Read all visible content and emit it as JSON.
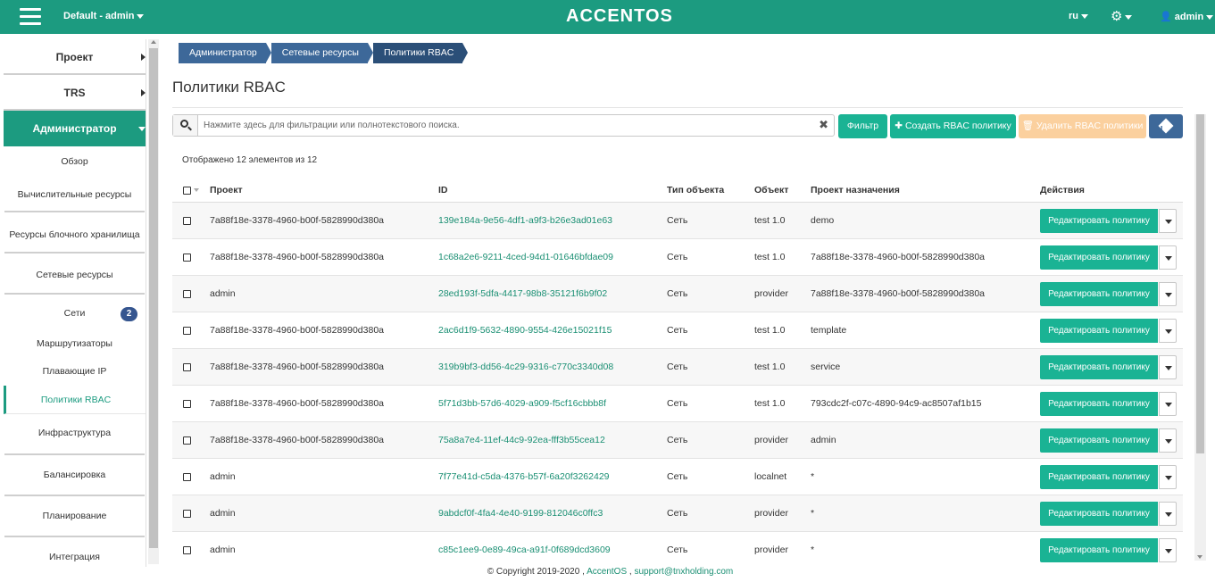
{
  "topbar": {
    "project": "Default - admin",
    "logo": "ACCENTOS",
    "lang": "ru",
    "user": "admin",
    "colors": {
      "brand": "#1c9b80",
      "breadcrumb": "#3d6899"
    }
  },
  "sidebar": {
    "sections": [
      "Проект",
      "TRS",
      "Администратор"
    ],
    "admin_items": [
      "Обзор",
      "Вычислительные ресурсы",
      "Ресурсы блочного хранилища",
      "Сетевые ресурсы"
    ],
    "network_items": [
      {
        "label": "Сети",
        "badge": "2"
      },
      {
        "label": "Маршрутизаторы"
      },
      {
        "label": "Плавающие IP"
      },
      {
        "label": "Политики RBAC"
      }
    ],
    "more_items": [
      "Инфраструктура",
      "Балансировка",
      "Планирование",
      "Интеграция"
    ]
  },
  "breadcrumbs": [
    "Администратор",
    "Сетевые ресурсы",
    "Политики RBAC"
  ],
  "page": {
    "title": "Политики RBAC",
    "search_placeholder": "Нажмите здесь для фильтрации или полнотекстового поиска.",
    "filter_label": "Фильтр",
    "create_label": "Создать RBAC политику",
    "delete_label": "Удалить RBAC политики",
    "count_text": "Отображено 12 элементов из 12"
  },
  "table": {
    "headers": [
      "Проект",
      "ID",
      "Тип объекта",
      "Объект",
      "Проект назначения",
      "Действия"
    ],
    "action_label": "Редактировать политику",
    "rows": [
      {
        "project": "7a88f18e-3378-4960-b00f-5828990d380a",
        "id": "139e184a-9e56-4df1-a9f3-b26e3ad01e63",
        "type": "Сеть",
        "object": "test 1.0",
        "target": "demo"
      },
      {
        "project": "7a88f18e-3378-4960-b00f-5828990d380a",
        "id": "1c68a2e6-9211-4ced-94d1-01646bfdae09",
        "type": "Сеть",
        "object": "test 1.0",
        "target": "7a88f18e-3378-4960-b00f-5828990d380a"
      },
      {
        "project": "admin",
        "id": "28ed193f-5dfa-4417-98b8-35121f6b9f02",
        "type": "Сеть",
        "object": "provider",
        "target": "7a88f18e-3378-4960-b00f-5828990d380a"
      },
      {
        "project": "7a88f18e-3378-4960-b00f-5828990d380a",
        "id": "2ac6d1f9-5632-4890-9554-426e15021f15",
        "type": "Сеть",
        "object": "test 1.0",
        "target": "template"
      },
      {
        "project": "7a88f18e-3378-4960-b00f-5828990d380a",
        "id": "319b9bf3-dd56-4c29-9316-c770c3340d08",
        "type": "Сеть",
        "object": "test 1.0",
        "target": "service"
      },
      {
        "project": "7a88f18e-3378-4960-b00f-5828990d380a",
        "id": "5f71d3bb-57d6-4029-a909-f5cf16cbbb8f",
        "type": "Сеть",
        "object": "test 1.0",
        "target": "793cdc2f-c07c-4890-94c9-ac8507af1b15"
      },
      {
        "project": "7a88f18e-3378-4960-b00f-5828990d380a",
        "id": "75a8a7e4-11ef-44c9-92ea-fff3b55cea12",
        "type": "Сеть",
        "object": "provider",
        "target": "admin"
      },
      {
        "project": "admin",
        "id": "7f77e41d-c5da-4376-b57f-6a20f3262429",
        "type": "Сеть",
        "object": "localnet",
        "target": "*"
      },
      {
        "project": "admin",
        "id": "9abdcf0f-4fa4-4e40-9199-812046c0ffc3",
        "type": "Сеть",
        "object": "provider",
        "target": "*"
      },
      {
        "project": "admin",
        "id": "c85c1ee9-0e89-49ca-a91f-0f689dcd3609",
        "type": "Сеть",
        "object": "provider",
        "target": "*"
      }
    ]
  },
  "footer": {
    "copyright": "© Copyright 2019-2020 ,",
    "product": "AccentOS",
    "sep": ",",
    "email": "support@tnxholding.com"
  }
}
